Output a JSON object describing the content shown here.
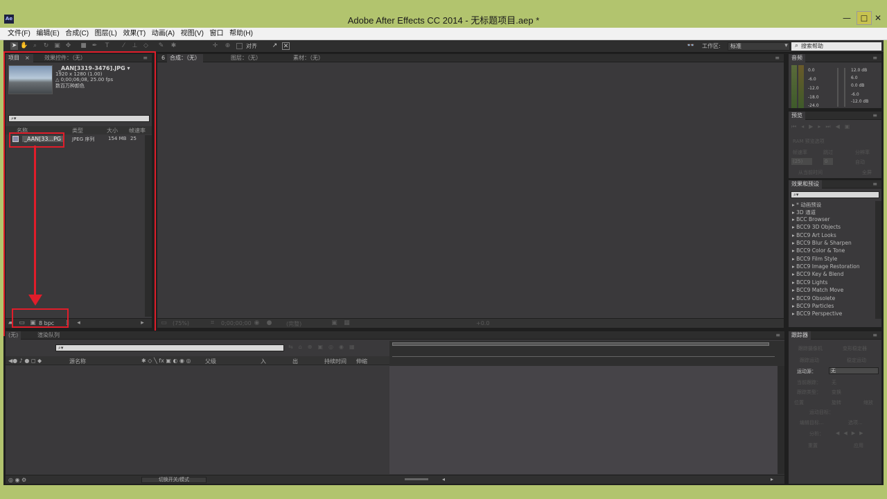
{
  "window": {
    "title": "Adobe After Effects CC 2014 - 无标题项目.aep *",
    "app_icon_label": "Ae",
    "minimize": "—",
    "maximize": "☐",
    "close": "✕"
  },
  "menu": [
    "文件(F)",
    "编辑(E)",
    "合成(C)",
    "图层(L)",
    "效果(T)",
    "动画(A)",
    "视图(V)",
    "窗口",
    "帮助(H)"
  ],
  "toolbar": {
    "snap_label": "对齐",
    "workspace_label": "工作区:",
    "workspace_value": "标准",
    "search_help_placeholder": "搜索帮助"
  },
  "project_panel": {
    "tab_project": "项目",
    "tab_effect_controls": "效果控件：（无）",
    "preview_name": "_AAN[3319-3476].JPG ▾",
    "preview_dims": "1920 x 1280 (1.00)",
    "preview_duration": "△ 0;00;06;08, 25.00 fps",
    "preview_colors": "数百万种颜色",
    "search_placeholder": "⌕▾",
    "columns": [
      "名称",
      "类型",
      "大小",
      "帧速率"
    ],
    "items": [
      {
        "name": "_AAN[33...PG",
        "type": "JPEG 序列",
        "size": "154 MB",
        "fps": "25"
      }
    ],
    "bpc": "8 bpc"
  },
  "comp_panel": {
    "tabs": [
      "合成：（无）",
      "图层：（无）",
      "素材：（无）"
    ],
    "zoom": "(75%)",
    "timecode": "0;00;00;00",
    "resolution": "(完整)",
    "exposure": "+0.0"
  },
  "audio_panel": {
    "tab": "音频",
    "left_scale": [
      "0.0",
      "-6.0",
      "-12.0",
      "-18.0",
      "-24.0"
    ],
    "right_scale": [
      "12.0 dB",
      "6.0",
      "0.0 dB",
      "-6.0",
      "-12.0 dB"
    ]
  },
  "preview_panel": {
    "tab": "预览",
    "ram_options": "RAM 预览选项",
    "frame_rate_label": "帧速率",
    "skip_label": "跳过",
    "resolution_label": "分辨率",
    "frame_rate_value": "(25)",
    "skip_value": "0",
    "resolution_value": "自动",
    "from_current": "从当前时间",
    "fullscreen": "全屏"
  },
  "effects_panel": {
    "tab": "效果和预设",
    "search_placeholder": "⌕▾",
    "items": [
      "* 动画预设",
      "3D 通道",
      "BCC Browser",
      "BCC9 3D Objects",
      "BCC9 Art Looks",
      "BCC9 Blur & Sharpen",
      "BCC9 Color & Tone",
      "BCC9 Film Style",
      "BCC9 Image Restoration",
      "BCC9 Key & Blend",
      "BCC9 Lights",
      "BCC9 Match Move",
      "BCC9 Obsolete",
      "BCC9 Particles",
      "BCC9 Perspective"
    ]
  },
  "timeline_panel": {
    "tab_none": "(无)",
    "tab_render": "渲染队列",
    "search_placeholder": "⌕▾",
    "columns": [
      "源名称",
      "父级",
      "入",
      "出",
      "持续时间",
      "伸缩"
    ],
    "toggle_label": "切换开关/模式"
  },
  "tracker_panel": {
    "tab": "跟踪器",
    "track_camera": "跟踪摄像机",
    "warp_stabilizer": "变形稳定器",
    "track_motion": "跟踪运动",
    "stabilize_motion": "稳定运动",
    "motion_source_label": "运动源：",
    "motion_source_value": "无",
    "current_track_label": "当前跟踪：",
    "current_track_value": "无",
    "track_type_label": "跟踪类型：",
    "track_type_value": "变换",
    "position": "位置",
    "rotation": "旋转",
    "scale": "缩放",
    "motion_target": "运动目标：",
    "edit_target": "编辑目标...",
    "options": "选项...",
    "analyze": "分析：",
    "reset": "重置",
    "apply": "应用"
  }
}
